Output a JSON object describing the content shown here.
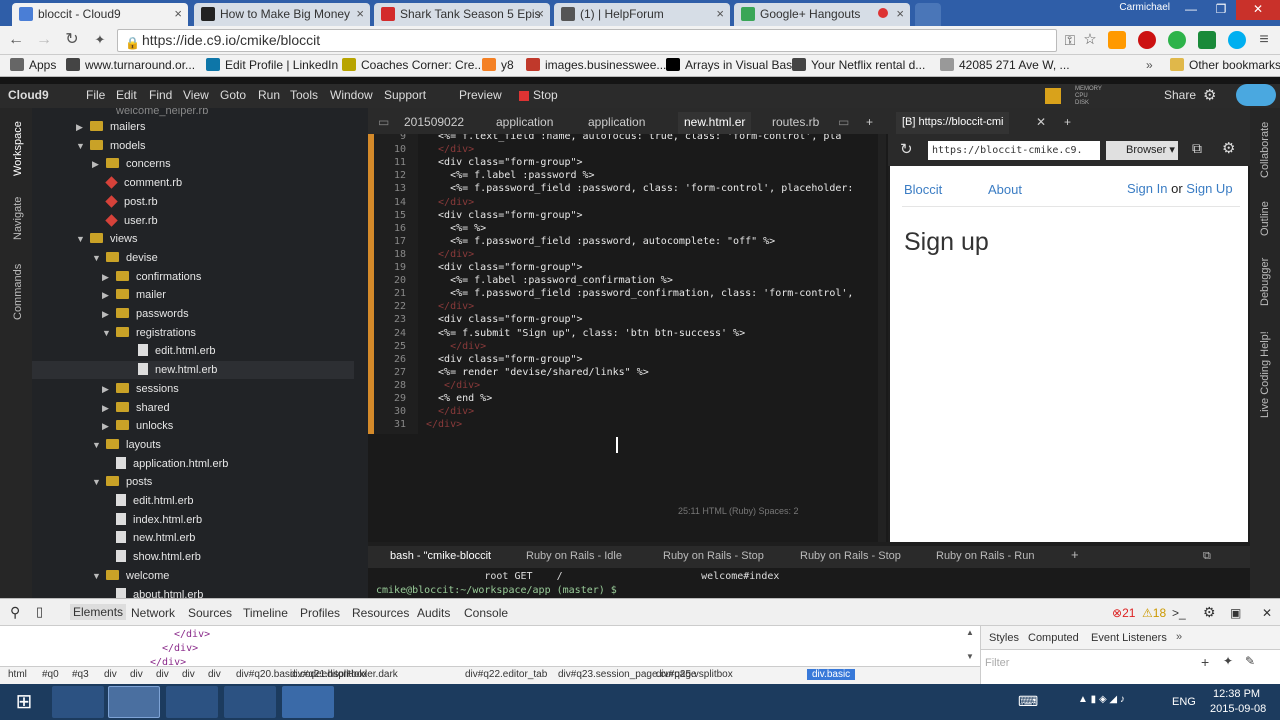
{
  "browser": {
    "tabs": [
      {
        "title": "bloccit - Cloud9",
        "color": "#4a7ed6"
      },
      {
        "title": "How to Make Big Money",
        "color": "#222222"
      },
      {
        "title": "Shark Tank Season 5 Epis",
        "color": "#d32b2b"
      },
      {
        "title": "(1) | HelpForum",
        "color": "#555555"
      },
      {
        "title": "Google+ Hangouts",
        "color": "#3aa657"
      }
    ],
    "user": "Carmichael",
    "url": "https://ide.c9.io/cmike/bloccit",
    "bookmarks": [
      {
        "label": "Apps",
        "color": "#666666"
      },
      {
        "label": "www.turnaround.or...",
        "color": "#444444"
      },
      {
        "label": "Edit Profile | LinkedIn",
        "color": "#0e76a8"
      },
      {
        "label": "Coaches Corner: Cre...",
        "color": "#b8a400"
      },
      {
        "label": "y8",
        "color": "#f48024"
      },
      {
        "label": "images.businesswee...",
        "color": "#c0392b"
      },
      {
        "label": "Arrays in Visual Basic",
        "color": "#000000"
      },
      {
        "label": "Your Netflix rental d...",
        "color": "#444444"
      },
      {
        "label": "42085 271 Ave W, ...",
        "color": "#999999"
      }
    ],
    "other_bookmarks": "Other bookmarks"
  },
  "c9": {
    "logo": "Cloud9",
    "menu": [
      "File",
      "Edit",
      "Find",
      "View",
      "Goto",
      "Run",
      "Tools",
      "Window",
      "Support"
    ],
    "preview": "Preview",
    "stop": "Stop",
    "share": "Share",
    "left_vtabs": [
      "Workspace",
      "Navigate",
      "Commands"
    ],
    "right_vtabs": [
      "Collaborate",
      "Outline",
      "Debugger",
      "Live Coding Help!"
    ],
    "tree": [
      {
        "label": "mailers",
        "type": "folder",
        "indent": 1,
        "arrow": "▶"
      },
      {
        "label": "models",
        "type": "folder",
        "indent": 1,
        "arrow": "▼"
      },
      {
        "label": "concerns",
        "type": "folder",
        "indent": 2,
        "arrow": "▶"
      },
      {
        "label": "comment.rb",
        "type": "rb",
        "indent": 2,
        "arrow": ""
      },
      {
        "label": "post.rb",
        "type": "rb",
        "indent": 2,
        "arrow": ""
      },
      {
        "label": "user.rb",
        "type": "rb",
        "indent": 2,
        "arrow": ""
      },
      {
        "label": "views",
        "type": "folder",
        "indent": 1,
        "arrow": "▼"
      },
      {
        "label": "devise",
        "type": "folder",
        "indent": 2,
        "arrow": "▼"
      },
      {
        "label": "confirmations",
        "type": "folder",
        "indent": 3,
        "arrow": "▶"
      },
      {
        "label": "mailer",
        "type": "folder",
        "indent": 3,
        "arrow": "▶"
      },
      {
        "label": "passwords",
        "type": "folder",
        "indent": 3,
        "arrow": "▶"
      },
      {
        "label": "registrations",
        "type": "folder",
        "indent": 3,
        "arrow": "▼"
      },
      {
        "label": "edit.html.erb",
        "type": "file",
        "indent": 4,
        "arrow": ""
      },
      {
        "label": "new.html.erb",
        "type": "file",
        "indent": 4,
        "arrow": "",
        "selected": true
      },
      {
        "label": "sessions",
        "type": "folder",
        "indent": 3,
        "arrow": "▶"
      },
      {
        "label": "shared",
        "type": "folder",
        "indent": 3,
        "arrow": "▶"
      },
      {
        "label": "unlocks",
        "type": "folder",
        "indent": 3,
        "arrow": "▶"
      },
      {
        "label": "layouts",
        "type": "folder",
        "indent": 2,
        "arrow": "▼"
      },
      {
        "label": "application.html.erb",
        "type": "file",
        "indent": 3,
        "arrow": ""
      },
      {
        "label": "posts",
        "type": "folder",
        "indent": 2,
        "arrow": "▼"
      },
      {
        "label": "edit.html.erb",
        "type": "file",
        "indent": 3,
        "arrow": ""
      },
      {
        "label": "index.html.erb",
        "type": "file",
        "indent": 3,
        "arrow": ""
      },
      {
        "label": "new.html.erb",
        "type": "file",
        "indent": 3,
        "arrow": ""
      },
      {
        "label": "show.html.erb",
        "type": "file",
        "indent": 3,
        "arrow": ""
      },
      {
        "label": "welcome",
        "type": "folder",
        "indent": 2,
        "arrow": "▼"
      },
      {
        "label": "about.html.erb",
        "type": "file",
        "indent": 3,
        "arrow": ""
      }
    ],
    "editor_tabs": [
      "201509022",
      "application",
      "application",
      "new.html.er",
      "routes.rb"
    ],
    "active_editor_tab": 3,
    "code": [
      {
        "n": "9",
        "text": "  <%= f.text_field :name, autofocus: true, class: 'form-control', pla"
      },
      {
        "n": "10",
        "text": "  </div>"
      },
      {
        "n": "11",
        "text": "  <div class=\"form-group\">"
      },
      {
        "n": "12",
        "text": "    <%= f.label :password %>"
      },
      {
        "n": "13",
        "text": "    <%= f.password_field :password, class: 'form-control', placeholder:"
      },
      {
        "n": "14",
        "text": "  </div>"
      },
      {
        "n": "15",
        "text": "  <div class=\"form-group\">"
      },
      {
        "n": "16",
        "text": "    <%= %>"
      },
      {
        "n": "17",
        "text": "    <%= f.password_field :password, autocomplete: \"off\" %>"
      },
      {
        "n": "18",
        "text": "  </div>"
      },
      {
        "n": "19",
        "text": "  <div class=\"form-group\">"
      },
      {
        "n": "20",
        "text": "    <%= f.label :password_confirmation %>"
      },
      {
        "n": "21",
        "text": "    <%= f.password_field :password_confirmation, class: 'form-control',"
      },
      {
        "n": "22",
        "text": "  </div>"
      },
      {
        "n": "23",
        "text": "  <div class=\"form-group\">"
      },
      {
        "n": "24",
        "text": "  <%= f.submit \"Sign up\", class: 'btn btn-success' %>"
      },
      {
        "n": "25",
        "text": "    </div>"
      },
      {
        "n": "26",
        "text": "  <div class=\"form-group\">"
      },
      {
        "n": "27",
        "text": "  <%= render \"devise/shared/links\" %>"
      },
      {
        "n": "28",
        "text": "   </div>"
      },
      {
        "n": "29",
        "text": "  <% end %>"
      },
      {
        "n": "30",
        "text": "  </div>"
      },
      {
        "n": "31",
        "text": "</div>"
      }
    ],
    "editor_status": "25:11   HTML (Ruby)   Spaces: 2",
    "preview_tab": "[B] https://bloccit-cmi",
    "preview_url": "https://bloccit-cmike.c9.",
    "preview_browser": "Browser",
    "console_tabs": [
      "bash - \"cmike-bloccit",
      "Ruby on Rails - Idle",
      "Ruby on Rails - Stop",
      "Ruby on Rails - Stop",
      "Ruby on Rails - Run"
    ],
    "console_line1": "                  root GET    /                       welcome#index",
    "console_prompt": "cmike@bloccit:~/workspace/app (master) $"
  },
  "site": {
    "brand": "Bloccit",
    "about": "About",
    "sign_in": "Sign In",
    "or": "or",
    "sign_up": "Sign Up",
    "heading": "Sign up"
  },
  "devtools": {
    "tabs": [
      "Elements",
      "Network",
      "Sources",
      "Timeline",
      "Profiles",
      "Resources",
      "Audits",
      "Console"
    ],
    "errors": "21",
    "warnings": "18",
    "dom_lines": [
      "</div>",
      "</div>",
      "</div>"
    ],
    "side_tabs": [
      "Styles",
      "Computed",
      "Event Listeners"
    ],
    "filter": "Filter",
    "crumbs": [
      "html",
      "#q0",
      "#q3",
      "div",
      "div",
      "div",
      "div",
      "div",
      "div#q20.basic.codeeditorHolder.dark",
      "div#q21.hsplitbox",
      "div#q22.editor_tab",
      "div#q23.session_page.curpage",
      "div#q25.vsplitbox",
      "div.basic"
    ]
  },
  "taskbar": {
    "time": "12:38 PM",
    "date": "2015-09-08",
    "lang": "ENG"
  }
}
